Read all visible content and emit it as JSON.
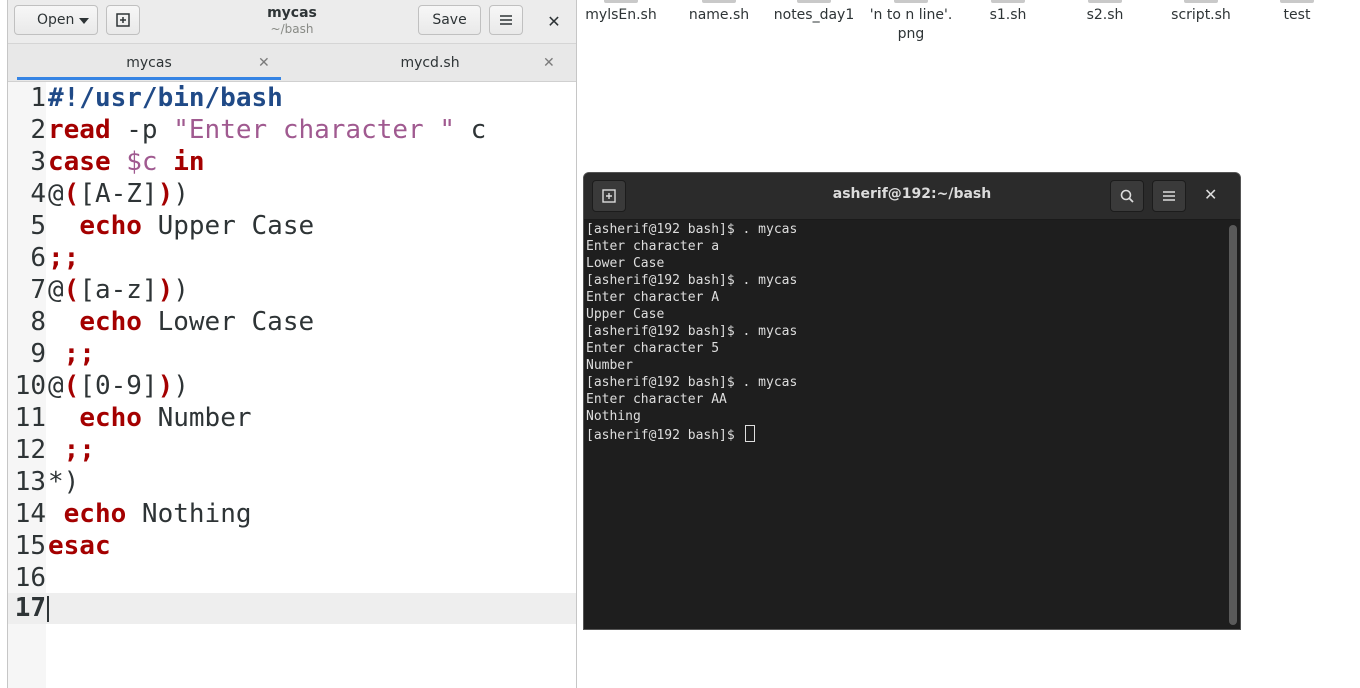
{
  "desktop_files": [
    "mylsEn.sh",
    "name.sh",
    "notes_day1",
    "'n to n line'.\npng",
    "s1.sh",
    "s2.sh",
    "script.sh",
    "test"
  ],
  "gedit": {
    "open_label": "Open",
    "title": "mycas",
    "subtitle": "~/bash",
    "save_label": "Save",
    "tabs": [
      {
        "label": "mycas"
      },
      {
        "label": "mycd.sh"
      }
    ],
    "current_line": "17",
    "line_numbers": [
      "1",
      "2",
      "3",
      "4",
      "5",
      "6",
      "7",
      "8",
      "9",
      "10",
      "11",
      "12",
      "13",
      "14",
      "15",
      "16",
      "17"
    ],
    "code": {
      "l1": "#!/usr/bin/bash",
      "l2_kw": "read",
      "l2_a": " -p ",
      "l2_str": "\"Enter character \"",
      "l2_b": " c",
      "l3_kw1": "case",
      "l3_var": " $c",
      "l3_kw2": " in",
      "l4_a": "@",
      "l4_p1": "(",
      "l4_b": "[A-Z]",
      "l4_p2": ")",
      "l4_c": ")",
      "l5_indent": "  ",
      "l5_kw": "echo",
      "l5_text": " Upper Case",
      "l6": ";;",
      "l7_a": "@",
      "l7_p1": "(",
      "l7_b": "[a-z]",
      "l7_p2": ")",
      "l7_c": ")",
      "l8_indent": "  ",
      "l8_kw": "echo",
      "l8_text": " Lower Case",
      "l9_indent": " ",
      "l9": ";;",
      "l10_a": "@",
      "l10_p1": "(",
      "l10_b": "[0-9]",
      "l10_p2": ")",
      "l10_c": ")",
      "l11_indent": "  ",
      "l11_kw": "echo",
      "l11_text": " Number",
      "l12_indent": " ",
      "l12": ";;",
      "l13": "*)",
      "l14_indent": " ",
      "l14_kw": "echo",
      "l14_text": " Nothing",
      "l15": "esac"
    }
  },
  "terminal": {
    "title": "asherif@192:~/bash",
    "lines": [
      "[asherif@192 bash]$ . mycas",
      "Enter character a",
      "Lower Case",
      "[asherif@192 bash]$ . mycas",
      "Enter character A",
      "Upper Case",
      "[asherif@192 bash]$ . mycas",
      "Enter character 5",
      "Number",
      "[asherif@192 bash]$ . mycas",
      "Enter character AA",
      "Nothing"
    ],
    "prompt": "[asherif@192 bash]$ "
  }
}
